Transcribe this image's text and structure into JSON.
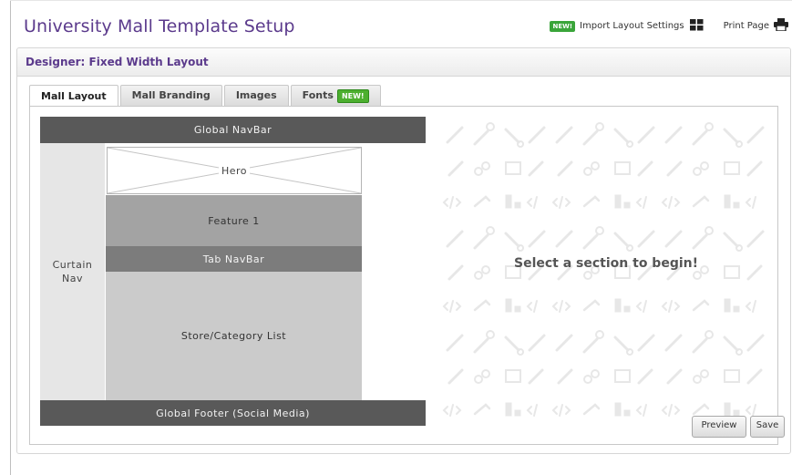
{
  "page": {
    "title": "University Mall Template Setup"
  },
  "top_actions": {
    "new_badge": "NEW!",
    "import_label": "Import Layout Settings",
    "print_label": "Print Page"
  },
  "designer": {
    "title": "Designer: Fixed Width Layout"
  },
  "tabs": [
    {
      "label": "Mall Layout",
      "active": true
    },
    {
      "label": "Mall Branding"
    },
    {
      "label": "Images"
    },
    {
      "label": "Fonts",
      "badge": "NEW!"
    }
  ],
  "layout": {
    "global_navbar": "Global NavBar",
    "curtain_nav": "Curtain Nav",
    "hero": "Hero",
    "feature": "Feature 1",
    "tab_navbar": "Tab NavBar",
    "store_list": "Store/Category List",
    "footer": "Global Footer (Social Media)"
  },
  "panel": {
    "prompt": "Select a section to begin!",
    "preview_button": "Preview",
    "save_button": "Save"
  },
  "icons": {
    "import": "grid-icon",
    "print": "printer-icon"
  },
  "colors": {
    "title_purple": "#5b3a8c",
    "new_green": "#4caf2f",
    "dark_section": "#595959",
    "mid_section": "#7c7c7c"
  }
}
